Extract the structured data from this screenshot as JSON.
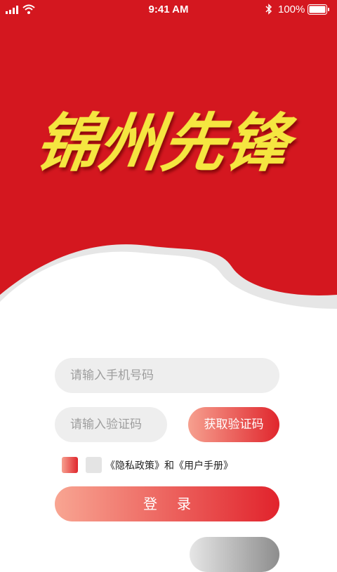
{
  "status_bar": {
    "time": "9:41 AM",
    "battery": "100%"
  },
  "hero": {
    "title": "锦州先锋",
    "background": "#d4171f",
    "title_color": "#f5e640"
  },
  "form": {
    "phone_placeholder": "请输入手机号码",
    "code_placeholder": "请输入验证码",
    "get_code_label": "获取验证码",
    "agreement_text": "《隐私政策》和《用户手册》",
    "login_label": "登录"
  }
}
